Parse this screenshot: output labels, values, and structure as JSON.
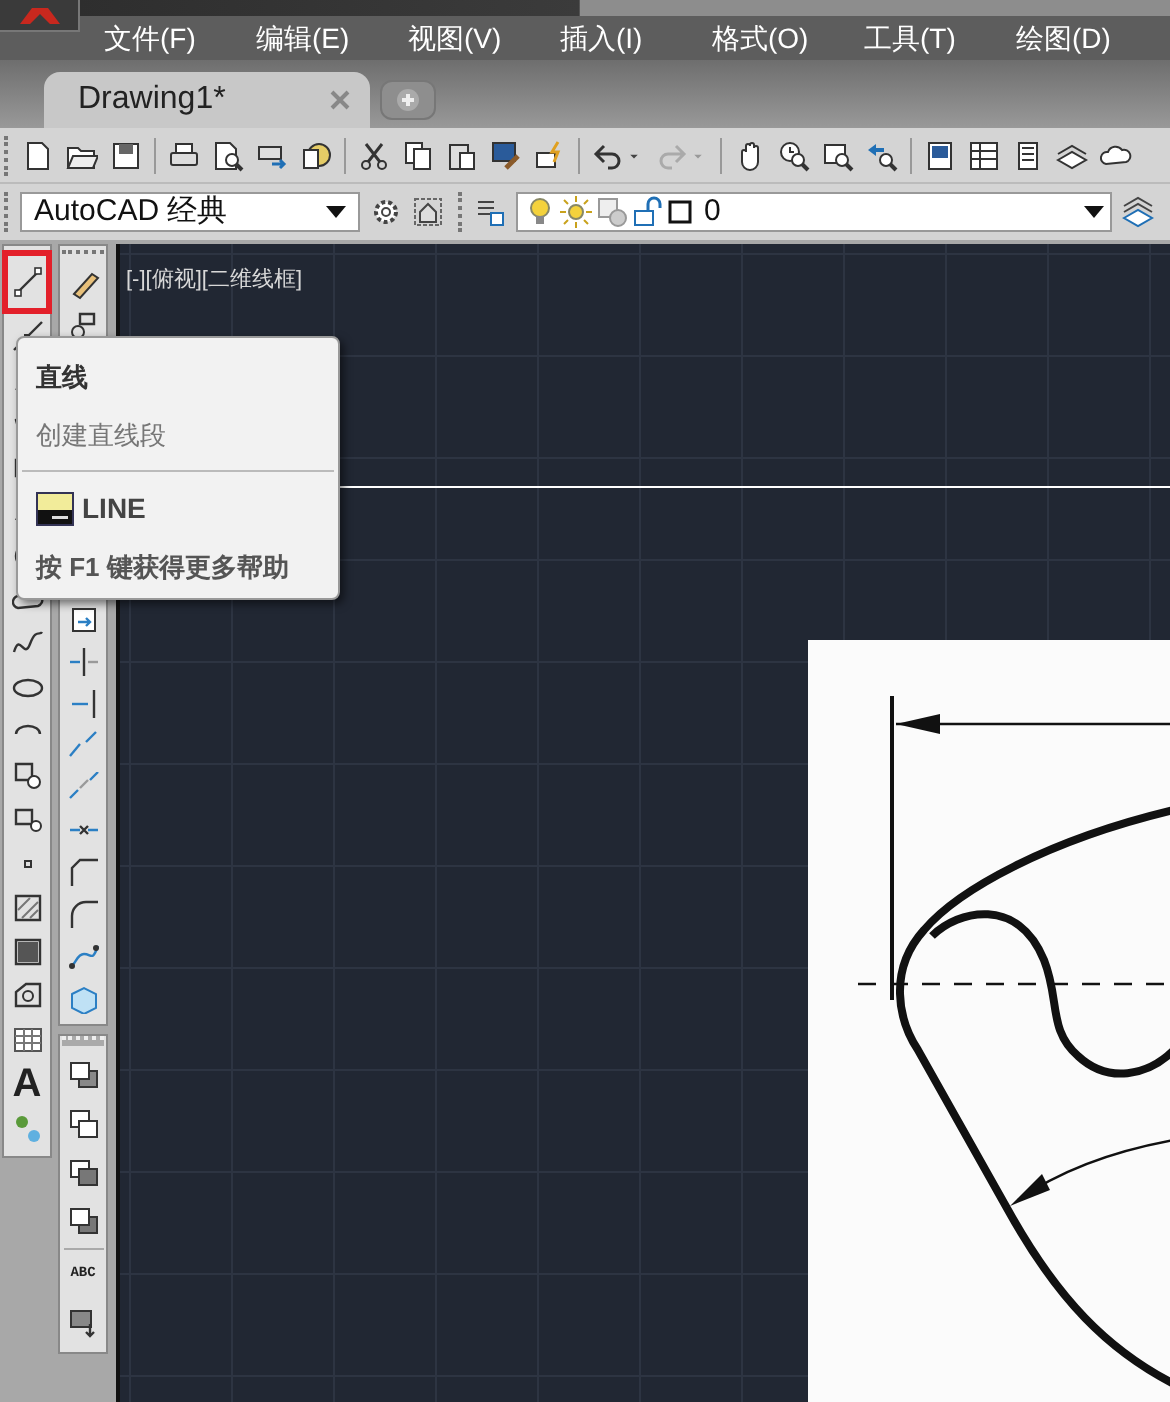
{
  "menu_bar": [
    {
      "label": "文件(F)"
    },
    {
      "label": "编辑(E)"
    },
    {
      "label": "视图(V)"
    },
    {
      "label": "插入(I)"
    },
    {
      "label": "格式(O)"
    },
    {
      "label": "工具(T)"
    },
    {
      "label": "绘图(D)"
    }
  ],
  "document_tabs": [
    {
      "label": "Drawing1*",
      "selected": true
    }
  ],
  "workspace_dropdown": {
    "value": "AutoCAD 经典"
  },
  "layer_dropdown": {
    "value": "0"
  },
  "draw_toolbar": {
    "line_tool_highlighted": true,
    "text_tool_glyph": "A"
  },
  "draw_order_toolbar": {
    "text_tool_glyph": "ABC"
  },
  "viewport_label": "[-][俯视][二维线框]",
  "tooltip": {
    "title": "直线",
    "description": "创建直线段",
    "command": "LINE",
    "help": "按 F1 键获得更多帮助"
  }
}
